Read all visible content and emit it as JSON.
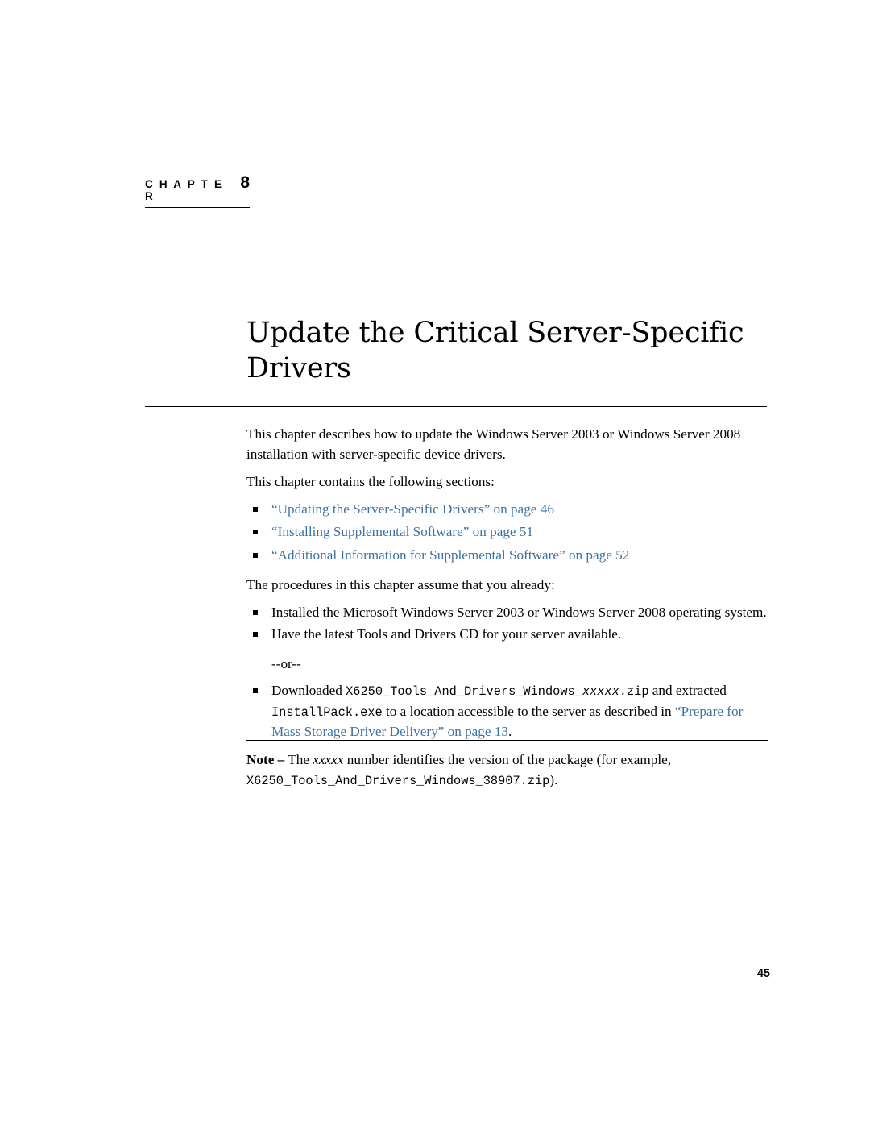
{
  "chapter": {
    "label": "C H A P T E R",
    "number": "8",
    "title": "Update the Critical Server-Specific Drivers"
  },
  "intro": {
    "paragraph1": "This chapter describes how to update the Windows Server 2003 or Windows Server 2008 installation with server-specific device drivers.",
    "paragraph2": "This chapter contains the following sections:"
  },
  "section_links": [
    "“Updating the Server-Specific Drivers” on page 46",
    "“Installing Supplemental Software” on page 51",
    "“Additional Information for Supplemental Software” on page 52"
  ],
  "assumptions": {
    "lead": "The procedures in this chapter assume that you already:",
    "items": [
      "Installed the Microsoft Windows Server 2003 or Windows Server 2008 operating system.",
      "Have the latest Tools and Drivers CD for your server available."
    ],
    "or_text": "--or--",
    "download_item": {
      "prefix": "Downloaded ",
      "file_mono": "X6250_Tools_And_Drivers_Windows_",
      "file_mono_italic": "xxxxx",
      "file_mono_suffix": ".zip",
      "middle": " and extracted ",
      "exe_mono": "InstallPack.exe",
      "tail": " to a location accessible to the server as described in ",
      "link": "“Prepare for Mass Storage Driver Delivery” on page 13",
      "end": "."
    }
  },
  "note": {
    "label": "Note –",
    "text_before": " The ",
    "italic": "xxxxx",
    "text_after": " number identifies the version of the package (for example, ",
    "example_mono": "X6250_Tools_And_Drivers_Windows_38907.zip",
    "end": ")."
  },
  "footer": {
    "page_number": "45"
  }
}
